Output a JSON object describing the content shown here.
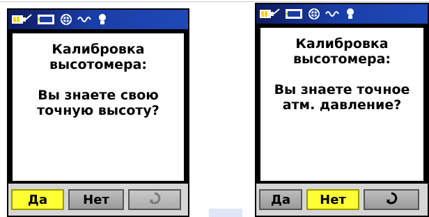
{
  "device_left": {
    "status_icons": [
      "battery-icon",
      "backlight-icon",
      "satellite-icon",
      "wave-icon",
      "light-bulb-icon"
    ],
    "title_lines": [
      "Калибровка",
      "высотомера:"
    ],
    "question_lines": [
      "Вы знаете свою",
      "точную высоту?"
    ],
    "buttons": {
      "yes": "Да",
      "no": "Нет",
      "page_icon": "rotate-icon"
    },
    "selected": "yes"
  },
  "device_right": {
    "status_icons": [
      "battery-icon",
      "backlight-icon",
      "satellite-icon",
      "wave-icon",
      "light-bulb-icon"
    ],
    "title_lines": [
      "Калибровка",
      "высотомера:"
    ],
    "question_lines": [
      "Вы знаете точное",
      "атм. давление?"
    ],
    "buttons": {
      "yes": "Да",
      "no": "Нет",
      "page_icon": "rotate-icon"
    },
    "selected": "no"
  },
  "colors": {
    "statusbar": "#1a3da6",
    "selected_button": "#ffff33",
    "button_bar": "#d6d6d6"
  }
}
